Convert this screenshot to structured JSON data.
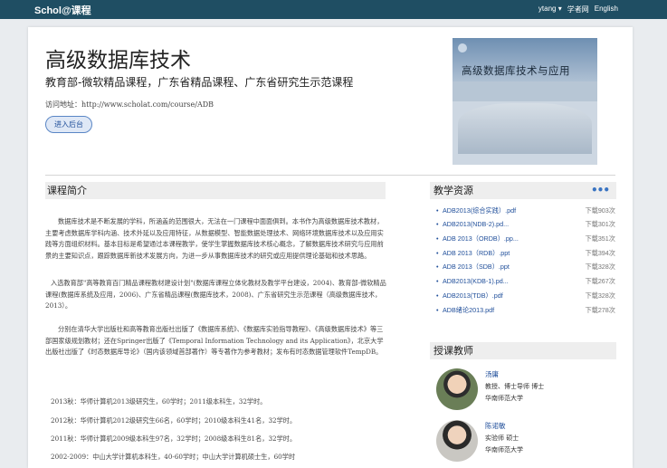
{
  "topbar": {
    "brand": "Schol@课程",
    "user": "ytang",
    "user_arrow": "▾",
    "link_scholar": "学者网",
    "link_english": "English"
  },
  "course": {
    "title": "高级数据库技术",
    "subtitle": "教育部-微软精品课程，广东省精品课程、广东省研究生示范课程",
    "url_label": "访问地址：",
    "url": "http://www.scholat.com/course/ADB",
    "enter_button": "进入后台"
  },
  "cover": {
    "title": "高级数据库技术与应用"
  },
  "intro": {
    "heading": "课程简介",
    "p1": "数据库技术是不断发展的学科，所涵盖的范围很大，无法在一门课程中面面俱到。本书作为高级数据库技术教材，主要考虑数据库学科内涵、技术外延以及应用特征，从数据模型、智能数据处理技术、网络环境数据库技术以及应用实践等方面组织材料。基本目标是希望通过本课程教学，使学生掌握数据库技术核心概念，了解数据库技术研究与应用前景的主要知识点，跟踪数据库新技术发展方向，为进一步从事数据库技术的研究或应用提供理论基础和技术思路。",
    "p2": "入选教育部\"高等教育百门精品课程教材建设计划\"(数据库课程立体化教材及教学平台建设，2004)、教育部-微软精品课程(数据库系统及应用，2006)、广东省精品课程(数据库技术，2008)、广东省研究生示范课程（高级数据库技术，2013）。",
    "p3": "分别在清华大学出版社和高等教育出版社出版了《数据库系统》、《数据库实验指导教程》、《高级数据库技术》等三部国家级规划教材；还在Springer出版了《Temporal Information Technology and its Application》，北京大学出版社出版了《时态数据库导论》（国内该领域首部著作）等专著作为参考教材；发布有时态数据管理软件TempDB。",
    "history": [
      "2013秋：华师计算机2013级研究生，60学时；2011级本科生，32学时。",
      "2012秋：华师计算机2012级研究生66名，60学时；2010级本科生41名，32学时。",
      "2011秋：华师计算机2009级本科生97名，32学时；2008级本科生81名，32学时。",
      "2002-2009：中山大学计算机本科生，40-60学时；中山大学计算机硕士生，60学时"
    ]
  },
  "resources": {
    "heading": "教学资源",
    "more": "•••",
    "items": [
      {
        "name": "ADB2013(综合实践）.pdf",
        "downloads": "下载903次"
      },
      {
        "name": "ADB2013(NDB-2).pd...",
        "downloads": "下载301次"
      },
      {
        "name": "ADB 2013（ORDB）.pp...",
        "downloads": "下载351次"
      },
      {
        "name": "ADB 2013（RDB）.ppt",
        "downloads": "下载394次"
      },
      {
        "name": "ADB 2013（SDB）.ppt",
        "downloads": "下载328次"
      },
      {
        "name": "ADB2013(KDB-1).pd...",
        "downloads": "下载267次"
      },
      {
        "name": "ADB2013(TDB）.pdf",
        "downloads": "下载328次"
      },
      {
        "name": "ADB绪论2013.pdf",
        "downloads": "下载278次"
      }
    ]
  },
  "teachers": {
    "heading": "授课教师",
    "list": [
      {
        "name": "汤庸",
        "title": "教授、博士导师 博士",
        "org": "华南师范大学"
      },
      {
        "name": "陈诺敏",
        "title": "实验师 硕士",
        "org": "华南师范大学"
      }
    ]
  }
}
